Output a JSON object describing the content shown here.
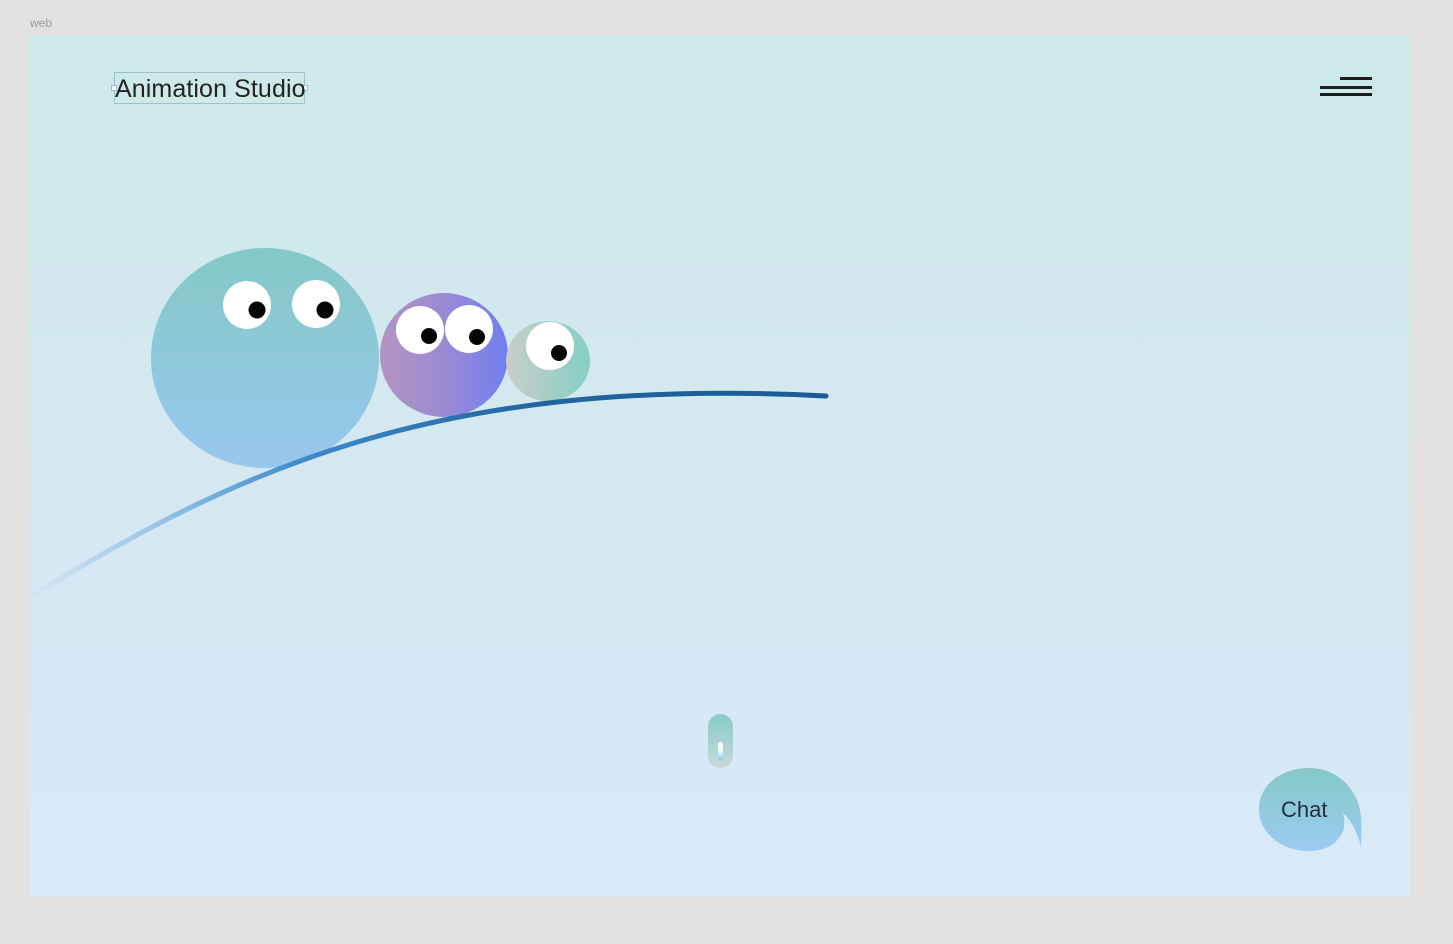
{
  "frame": {
    "label": "web"
  },
  "header": {
    "title": "Animation Studio",
    "menu_icon": "hamburger-menu-icon"
  },
  "scene": {
    "characters": [
      {
        "name": "large-teal-blob",
        "eyes": 2,
        "color_top": "#84c9c5",
        "color_bottom": "#98c7ef"
      },
      {
        "name": "medium-purple-blob",
        "eyes": 2,
        "color_left": "#b294c0",
        "color_right": "#6f7ff0"
      },
      {
        "name": "small-gray-teal-blob",
        "eyes": 1,
        "color_left": "#c7cdc8",
        "color_right": "#84cfc4"
      }
    ],
    "track_color": "#1f5e96"
  },
  "scroll_indicator": {
    "icon": "scroll-indicator-icon"
  },
  "chat": {
    "label": "Chat",
    "color_top": "#84c9c5",
    "color_bottom": "#9ccbf2"
  },
  "colors": {
    "background_top": "#cde9e8",
    "background_bottom": "#d8e9f8",
    "frame_background": "#e2e2e2",
    "text_dark": "#222222"
  }
}
